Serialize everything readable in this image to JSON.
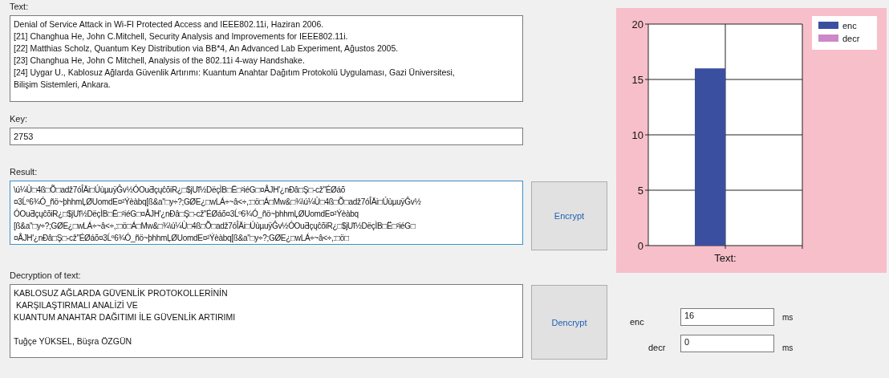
{
  "text_section": {
    "label": "Text:",
    "lines": [
      "Denial of Service Attack in Wi-FI Protected Access and IEEE802.11i, Haziran 2006.",
      "[21] Changhua He, John C.Mitchell, Security Analysis and Improvements for IEEE802.11i.",
      "[22] Matthias Scholz, Quantum Key Distribution via BB*4, An Advanced Lab Experiment, Ağustos 2005.",
      "[23] Changhua He, John C Mitchell, Analysis of the 802.11i 4-way Handshake.",
      "[24] Uygar U., Kablosuz Ağlarda Güvenlik Artırımı: Kuantum Anahtar Dağıtım Protokolü Uygulaması, Gazi Üniversitesi,",
      "Bilişim Sistemleri, Ankara."
    ]
  },
  "key": {
    "label": "Key:",
    "value": "2753"
  },
  "result": {
    "label": "Result:",
    "lines": [
      "\\ú¼Ù□4ß□Õ□adž7óÎÄi□ÚùµuÿĜv½ÓOuƋçųĉõiR¿□$jUĭ½DëçÌB□Ë□²iéG□¤ÅJH'¿nÐâ□Ş□-cž\"ÉØáõ",
      "¤3Ĺº6¾Ó_ñö~þhhmĻØUomdE¤²Ýèàbq[ß&a\"□y÷?;GØE¿□wLÁ÷~â<÷,:□ö□Á□Mw&□¾\\ú¼Ù□4ß□Õ□adž7óÎÄi□ÚùµuÿĜv½",
      "ÓOuƋçųĉõiR¿□$jUĭ½DëçÌB□Ë□²iéG□¤ÅJH'¿nÐâ□Ş□-cž\"ÉØáõ¤3Ĺº6¾Ó_ñö~þhhmĻØUomdE¤²Ýèàbq",
      "[ß&a\"□y÷?;GØE¿□wLÁ÷~â<÷,:□ö□Á□Mw&□¾\\ú¼Ù□4ß□Õ□adž7óÎÄi□ÚùµuÿĜv½ÓOuƋçųĉõiR¿□$jUĭ½DëçÌB□Ë□²iéG□",
      "¤ÅJH'¿nÐâ□Ş□-cž\"ÉØáõ¤3Ĺº6¾Ó_ñö~þhhmĻØUomdE¤²Ýèàbq[ß&a\"□y÷?;GØE¿□wLÁ÷~â<÷,:□ö□"
    ]
  },
  "encrypt_button": "Encrypt",
  "decryption": {
    "label": "Decryption of text:",
    "lines": [
      "KABLOSUZ AĞLARDA GÜVENLİK PROTOKOLLERİNİN",
      " KARŞILAŞTIRMALI ANALİZİ VE",
      "KUANTUM ANAHTAR DAĞITIMI İLE GÜVENLİK ARTIRIMI"
    ],
    "signature": "Tuğçe YÜKSEL, Büşra ÖZGÜN"
  },
  "decrypt_button": "Dencrypt",
  "chart": {
    "category_suffix": ":",
    "chart_data": {
      "type": "bar",
      "grid": true,
      "categories": [
        "Text"
      ],
      "series": [
        {
          "name": "enc",
          "color": "#3a4fa0",
          "values": [
            16
          ]
        },
        {
          "name": "decr",
          "color": "#cc88c8",
          "values": [
            0
          ]
        }
      ],
      "ylim": [
        0,
        20
      ],
      "yticks": [
        0,
        5,
        10,
        15,
        20
      ]
    }
  },
  "timings": [
    {
      "label": "enc",
      "value": "16",
      "unit": "ms"
    },
    {
      "label": "decr",
      "value": "0",
      "unit": "ms"
    }
  ]
}
